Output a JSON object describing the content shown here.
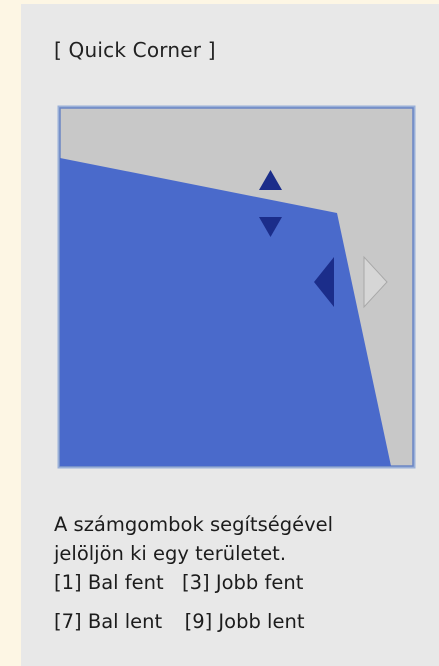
{
  "title": "[ Quick Corner ]",
  "colors": {
    "background": "#fdf6e4",
    "panel": "#e8e8e8",
    "frame": "#9ab0d8",
    "frame_inner": "#6a85c4",
    "area_gray": "#c8c8c8",
    "projection_fill": "#4a6acb",
    "arrow_active": "#1b2d8a",
    "arrow_inactive": "#d6d6d6"
  },
  "arrows": {
    "up": "active",
    "down": "active",
    "left": "active",
    "right": "inactive"
  },
  "instructions": {
    "line1": "A számgombok segítségével",
    "line2": "jelöljön ki egy területet.",
    "corner1": "[1] Bal fent",
    "corner3": "[3] Jobb fent",
    "corner7": "[7] Bal lent",
    "corner9": "[9] Jobb lent"
  }
}
